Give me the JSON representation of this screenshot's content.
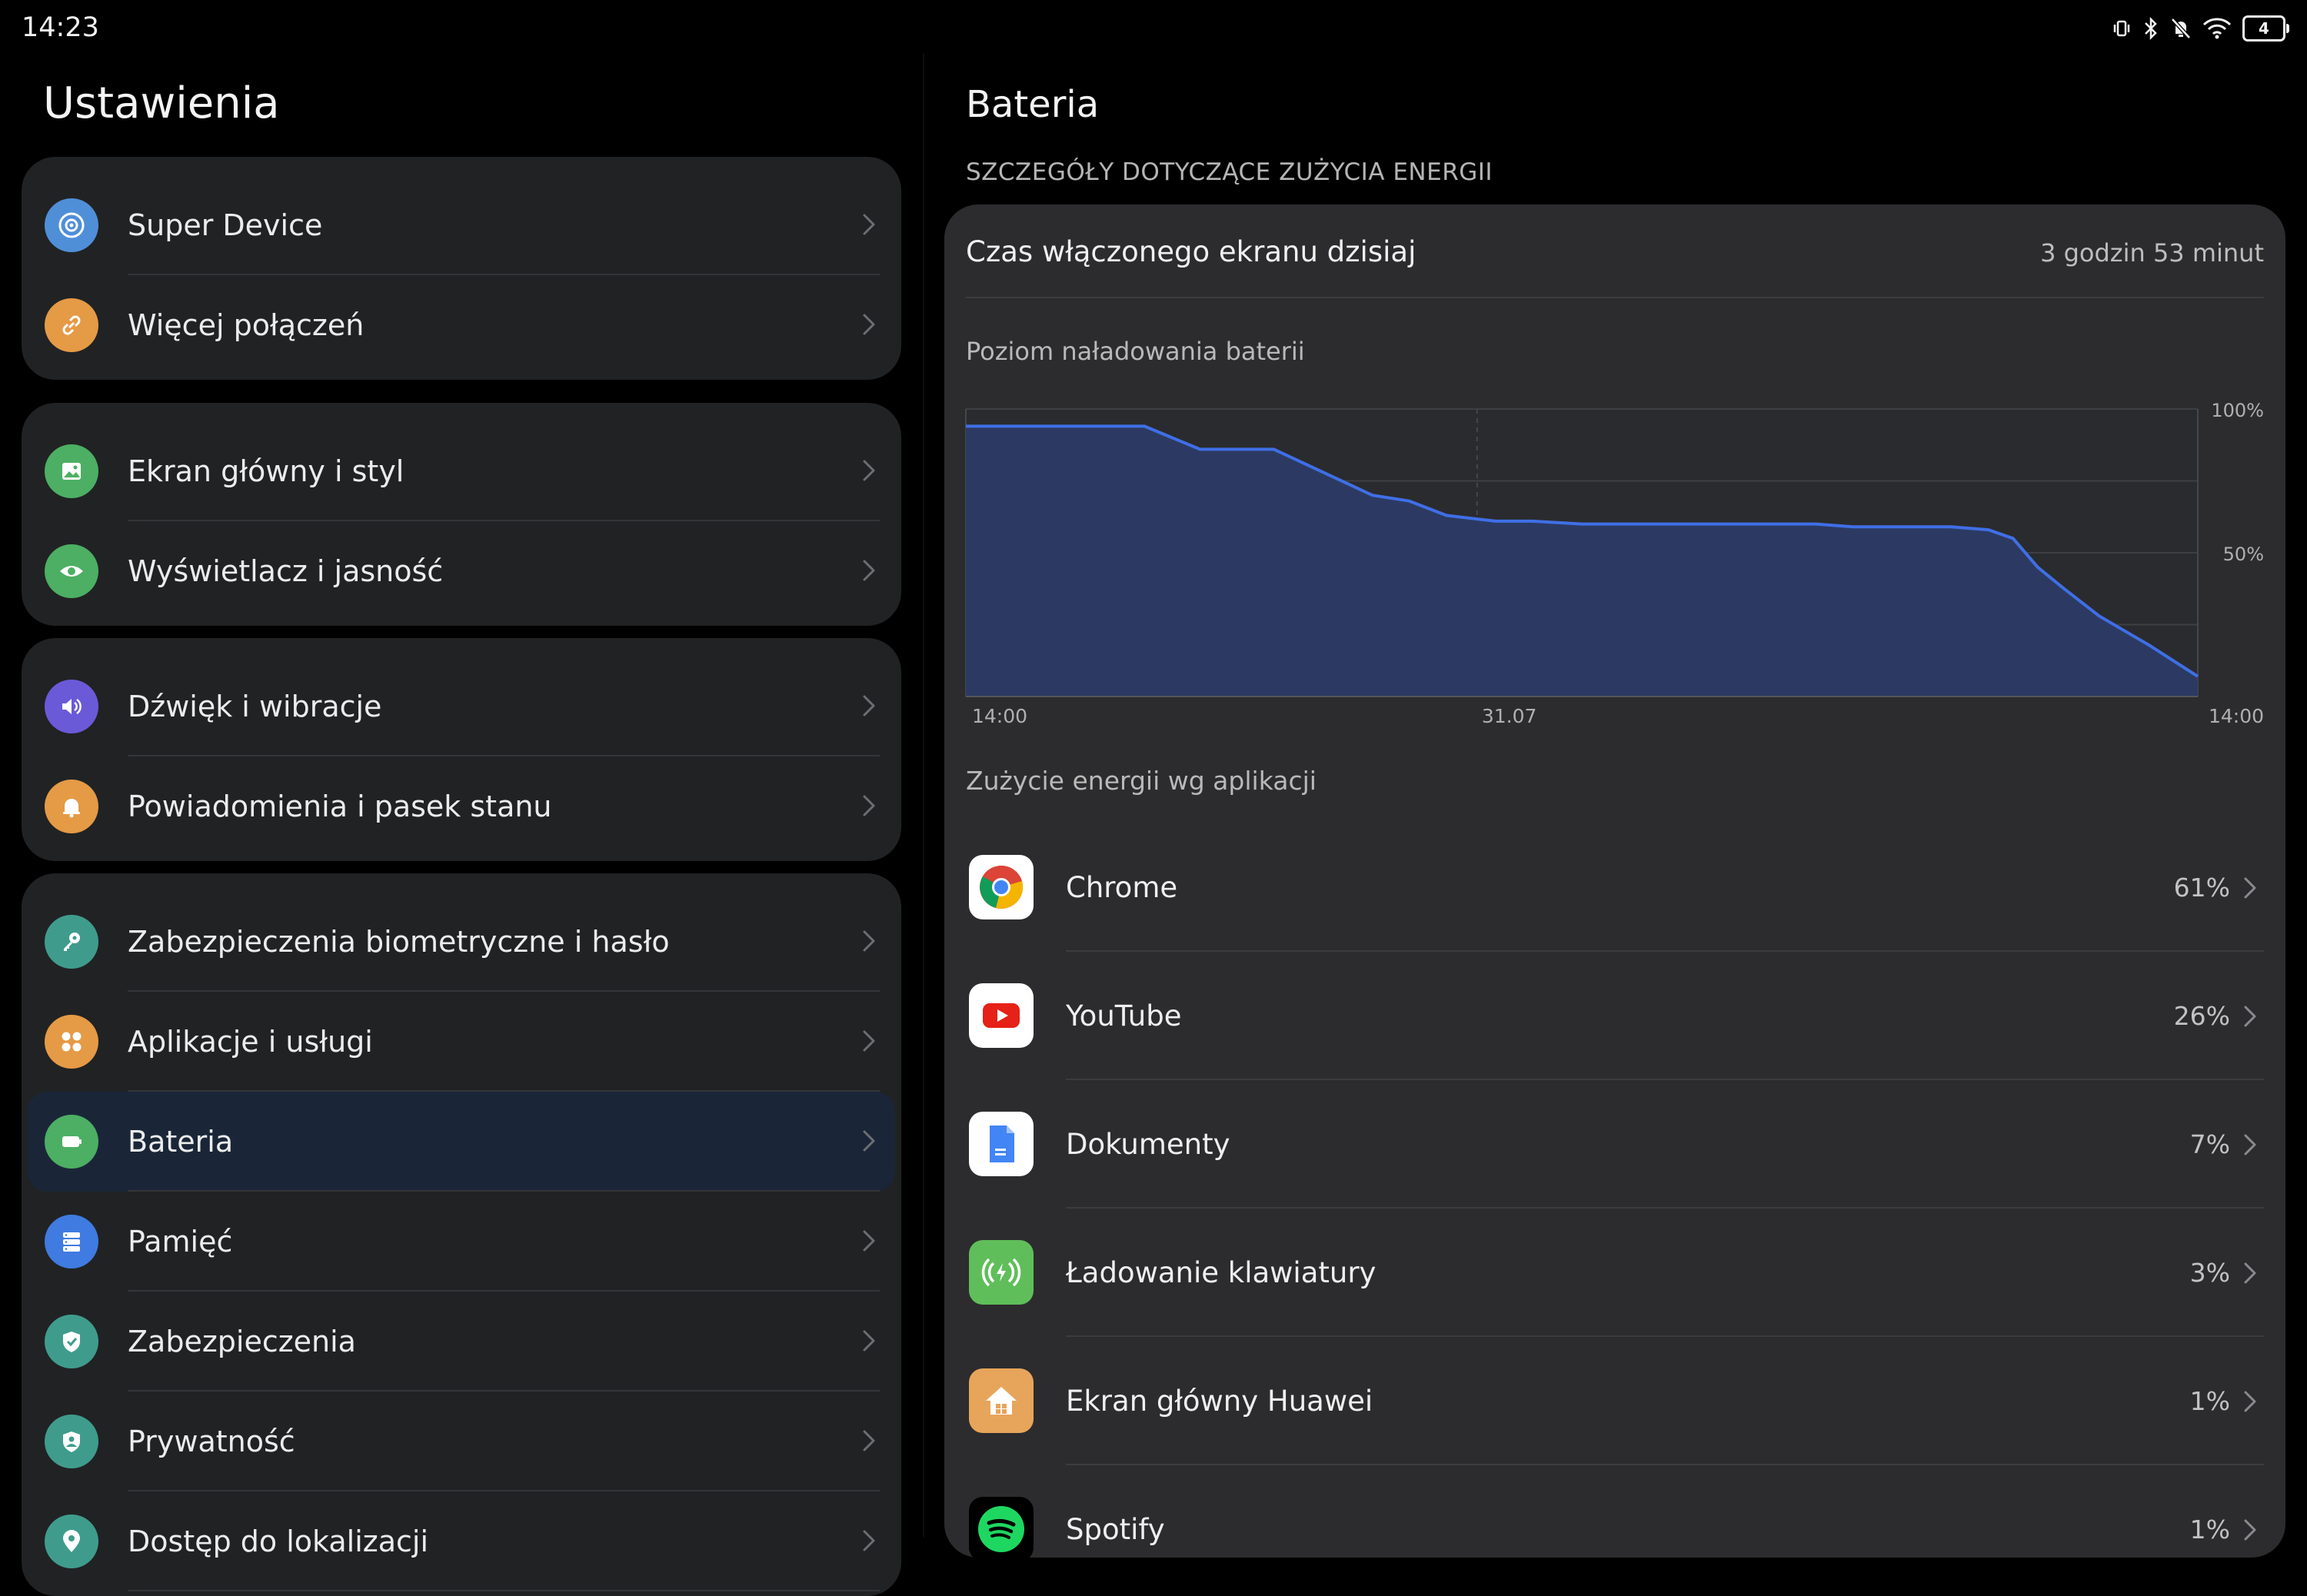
{
  "status_bar": {
    "time": "14:23",
    "icons": [
      "vibrate-icon",
      "bluetooth-icon",
      "mute-bell-icon",
      "wifi-icon"
    ],
    "battery_level": "4"
  },
  "left": {
    "title": "Ustawienia",
    "groups": [
      {
        "items": [
          {
            "label": "Super Device",
            "icon": "super-device-icon",
            "color": "#4f8fd8"
          },
          {
            "label": "Więcej połączeń",
            "icon": "link-icon",
            "color": "#e59a45"
          }
        ]
      },
      {
        "items": [
          {
            "label": "Ekran główny i styl",
            "icon": "image-icon",
            "color": "#4caf63"
          },
          {
            "label": "Wyświetlacz i jasność",
            "icon": "eye-icon",
            "color": "#4caf63"
          }
        ]
      },
      {
        "items": [
          {
            "label": "Dźwięk i wibracje",
            "icon": "speaker-icon",
            "color": "#6a5ad8"
          },
          {
            "label": "Powiadomienia i pasek stanu",
            "icon": "bell-icon",
            "color": "#e59a45"
          }
        ]
      },
      {
        "items": [
          {
            "label": "Zabezpieczenia biometryczne i hasło",
            "icon": "key-icon",
            "color": "#3f9c8c"
          },
          {
            "label": "Aplikacje i usługi",
            "icon": "apps-icon",
            "color": "#e59a45"
          },
          {
            "label": "Bateria",
            "icon": "battery-icon",
            "color": "#4caf63",
            "selected": true
          },
          {
            "label": "Pamięć",
            "icon": "storage-icon",
            "color": "#3f7be0"
          },
          {
            "label": "Zabezpieczenia",
            "icon": "shield-icon",
            "color": "#3f9c8c"
          },
          {
            "label": "Prywatność",
            "icon": "privacy-icon",
            "color": "#3f9c8c"
          },
          {
            "label": "Dostęp do lokalizacji",
            "icon": "location-icon",
            "color": "#3f9c8c"
          }
        ]
      }
    ]
  },
  "right": {
    "title": "Bateria",
    "subtitle": "SZCZEGÓŁY DOTYCZĄCE ZUŻYCIA ENERGII",
    "screen_time_label": "Czas włączonego ekranu dzisiaj",
    "screen_time_value": "3 godzin 53 minut",
    "battery_level_label": "Poziom naładowania baterii",
    "usage_label": "Zużycie energii wg aplikacji",
    "apps": [
      {
        "name": "Chrome",
        "pct": "61%",
        "icon": "chrome-icon"
      },
      {
        "name": "YouTube",
        "pct": "26%",
        "icon": "youtube-icon"
      },
      {
        "name": "Dokumenty",
        "pct": "7%",
        "icon": "docs-icon"
      },
      {
        "name": "Ładowanie klawiatury",
        "pct": "3%",
        "icon": "keyboard-charging-icon"
      },
      {
        "name": "Ekran główny Huawei",
        "pct": "1%",
        "icon": "home-icon"
      },
      {
        "name": "Spotify",
        "pct": "1%",
        "icon": "spotify-icon"
      }
    ]
  },
  "chart_data": {
    "type": "area",
    "title": "Poziom naładowania baterii",
    "x_tick_labels": [
      "14:00",
      "31.07",
      "14:00"
    ],
    "y_tick_labels": [
      "100%",
      "50%"
    ],
    "ylim": [
      0,
      100
    ],
    "grid": true,
    "accent_color": "#3f6fe6",
    "fill_color": "#2c3a63",
    "x": [
      0,
      0.145,
      0.19,
      0.25,
      0.29,
      0.33,
      0.36,
      0.39,
      0.43,
      0.46,
      0.5,
      0.6,
      0.69,
      0.72,
      0.8,
      0.83,
      0.85,
      0.87,
      0.89,
      0.92,
      0.96,
      1.0
    ],
    "values": [
      94,
      94,
      86,
      86,
      78,
      70,
      68,
      63,
      61,
      61,
      60,
      60,
      60,
      59,
      59,
      58,
      55,
      45,
      38,
      28,
      18,
      7
    ]
  }
}
